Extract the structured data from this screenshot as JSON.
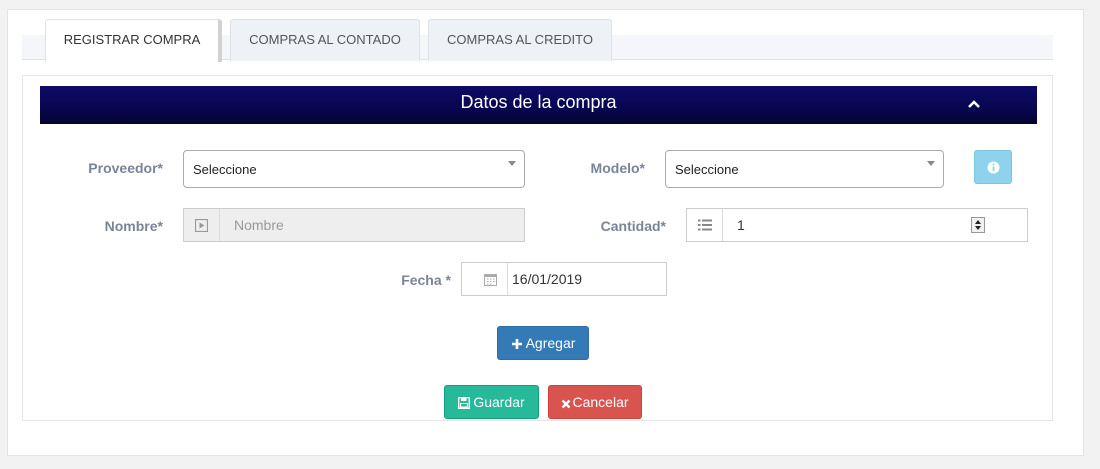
{
  "tabs": [
    {
      "label": "REGISTRAR COMPRA",
      "active": true
    },
    {
      "label": "COMPRAS AL CONTADO",
      "active": false
    },
    {
      "label": "COMPRAS AL CREDITO",
      "active": false
    }
  ],
  "panel": {
    "title": "Datos de la compra",
    "collapse_icon": "chevron-up-icon"
  },
  "form": {
    "proveedor": {
      "label": "Proveedor*",
      "value": "Seleccione"
    },
    "modelo": {
      "label": "Modelo*",
      "value": "Seleccione"
    },
    "nombre": {
      "label": "Nombre*",
      "placeholder": "Nombre"
    },
    "cantidad": {
      "label": "Cantidad*",
      "value": "1"
    },
    "fecha": {
      "label": "Fecha *",
      "value": "16/01/2019"
    }
  },
  "buttons": {
    "agregar": "Agregar",
    "guardar": "Guardar",
    "cancelar": "Cancelar"
  },
  "colors": {
    "header_bg": "#080650",
    "primary": "#337ab7",
    "success": "#26b99a",
    "danger": "#d9534f",
    "info": "#8fd2ee",
    "label": "#7a8499"
  }
}
